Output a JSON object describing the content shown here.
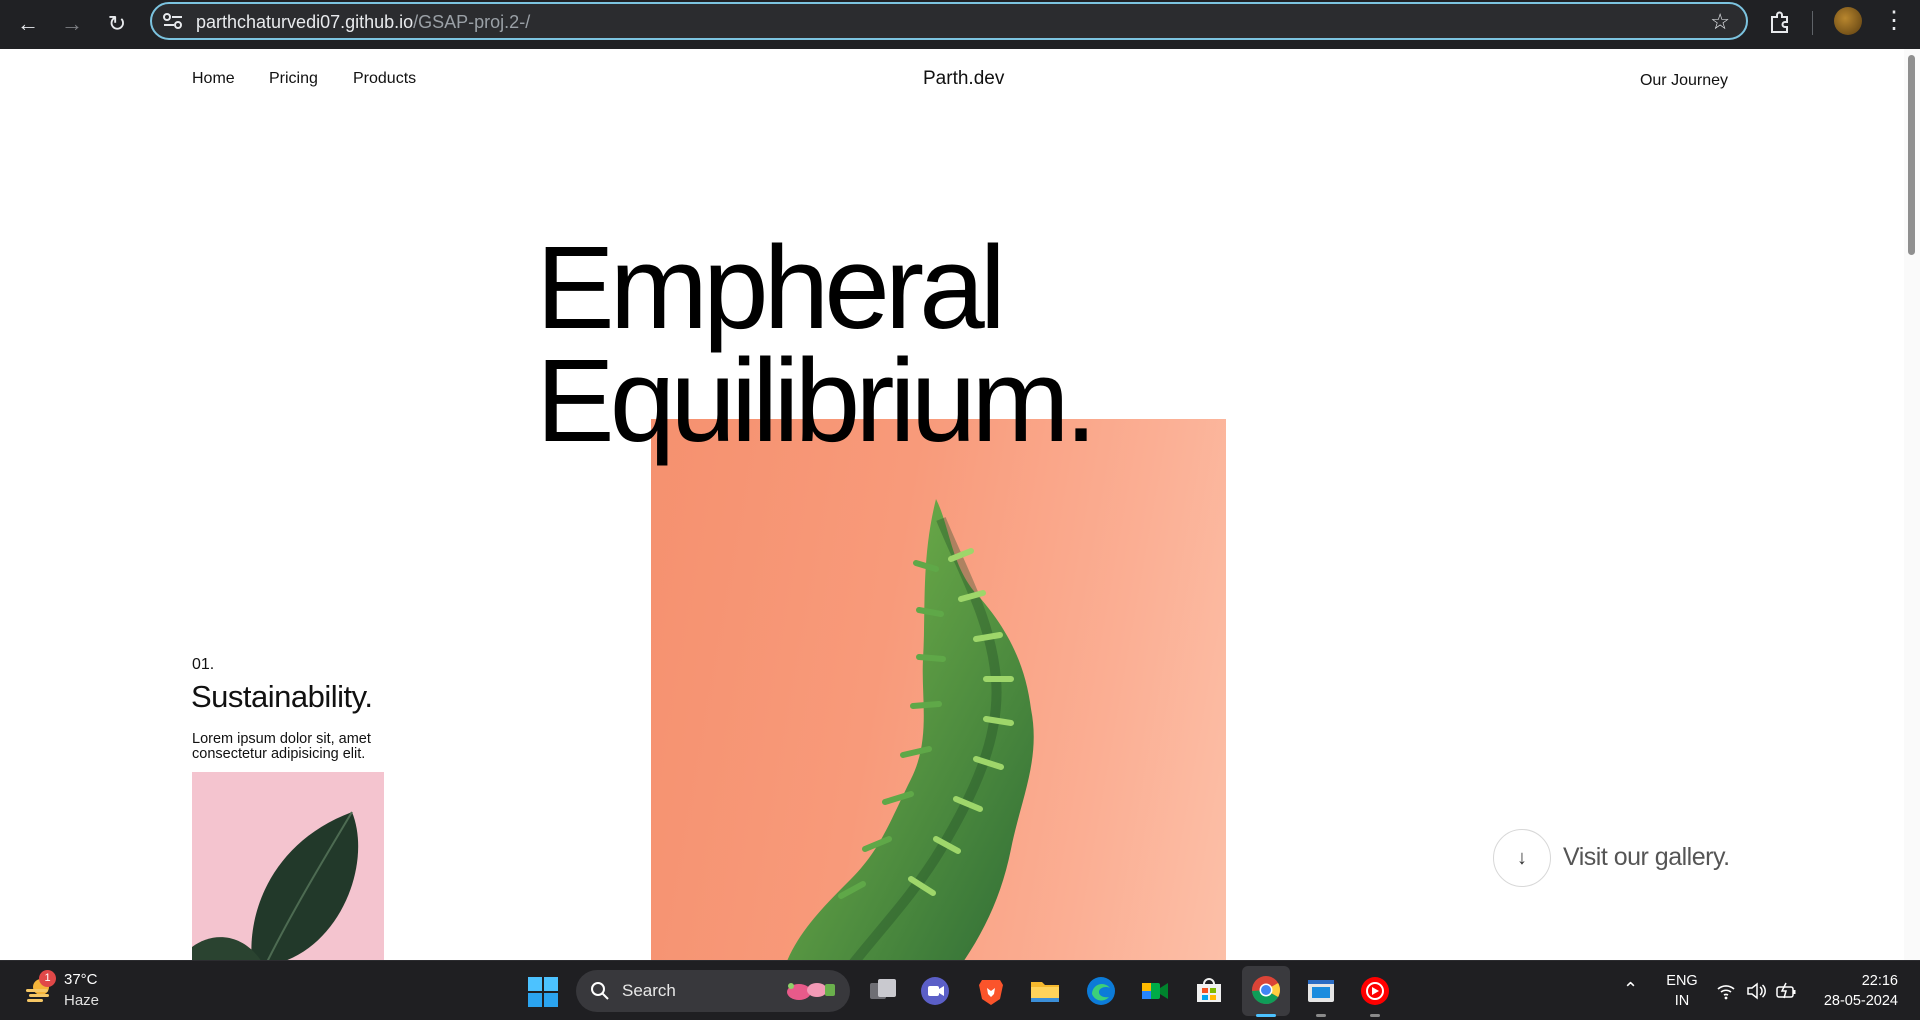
{
  "browser": {
    "url_host": "parthchaturvedi07.github.io",
    "url_path": "/GSAP-proj.2-/"
  },
  "site": {
    "nav": [
      "Home",
      "Pricing",
      "Products"
    ],
    "brand": "Parth.dev",
    "journey_link": "Our Journey",
    "hero_line1": "Empheral",
    "hero_line2": "Equilibrium.",
    "feature": {
      "number": "01.",
      "title": "Sustainability.",
      "description": "Lorem ipsum dolor sit, amet consectetur adipisicing elit."
    },
    "gallery_link": "Visit our gallery."
  },
  "taskbar": {
    "weather_badge": "1",
    "weather_temp": "37°C",
    "weather_condition": "Haze",
    "search_label": "Search",
    "lang_line1": "ENG",
    "lang_line2": "IN",
    "time": "22:16",
    "date": "28-05-2024"
  }
}
